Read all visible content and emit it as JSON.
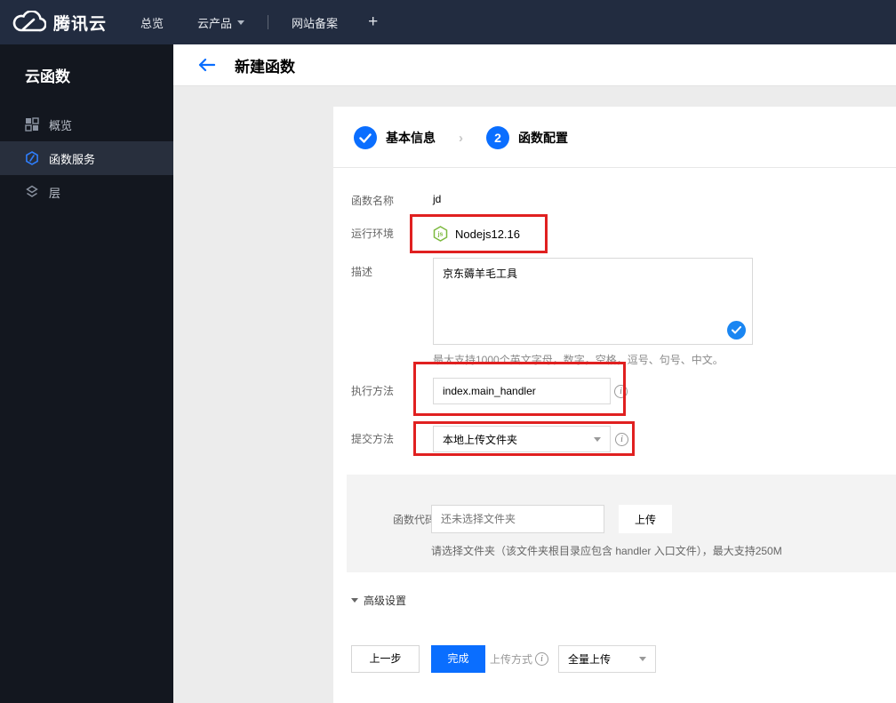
{
  "navbar": {
    "brand": "腾讯云",
    "items": [
      {
        "label": "总览"
      },
      {
        "label": "云产品"
      },
      {
        "label": "网站备案"
      }
    ],
    "plus": "+"
  },
  "sidebar": {
    "title": "云函数",
    "items": [
      {
        "label": "概览"
      },
      {
        "label": "函数服务"
      },
      {
        "label": "层"
      }
    ]
  },
  "header": {
    "title": "新建函数"
  },
  "steps": {
    "step1": {
      "label": "基本信息"
    },
    "step2": {
      "number": "2",
      "label": "函数配置"
    }
  },
  "form": {
    "name": {
      "label": "函数名称",
      "value": "jd"
    },
    "runtime": {
      "label": "运行环境",
      "value": "Nodejs12.16"
    },
    "description": {
      "label": "描述",
      "value": "京东薅羊毛工具",
      "hint": "最大支持1000个英文字母，数字，空格，逗号、句号、中文。"
    },
    "handler": {
      "label": "执行方法",
      "value": "index.main_handler"
    },
    "submit_method": {
      "label": "提交方法",
      "value": "本地上传文件夹"
    },
    "code": {
      "label": "函数代码",
      "required_mark": "*",
      "placeholder": "还未选择文件夹",
      "upload_button": "上传",
      "hint": "请选择文件夹（该文件夹根目录应包含 handler 入口文件），最大支持250M"
    },
    "advanced": {
      "label": "高级设置"
    }
  },
  "footer": {
    "prev_button": "上一步",
    "finish_button": "完成",
    "upload_mode_label": "上传方式",
    "upload_mode_value": "全量上传"
  },
  "colors": {
    "accent_blue": "#0a6eff",
    "annotation_red": "#e02020",
    "node_green": "#7cb93e",
    "navbar_bg": "#222c40",
    "sidebar_bg": "#13171f"
  }
}
